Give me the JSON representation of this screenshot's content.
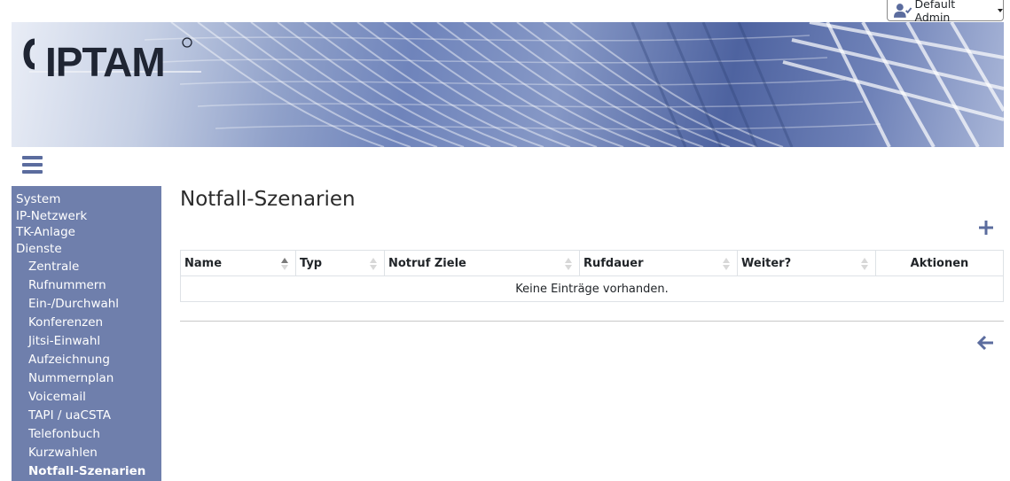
{
  "user": {
    "name": "Default Admin",
    "icon": "user-check-icon"
  },
  "logo": {
    "text": "IPTAM"
  },
  "sidebar": {
    "top_items": [
      {
        "label": "System"
      },
      {
        "label": "IP-Netzwerk"
      },
      {
        "label": "TK-Anlage"
      },
      {
        "label": "Dienste"
      }
    ],
    "sub_items": [
      {
        "label": "Zentrale"
      },
      {
        "label": "Rufnummern"
      },
      {
        "label": "Ein-/Durchwahl"
      },
      {
        "label": "Konferenzen"
      },
      {
        "label": "Jitsi-Einwahl"
      },
      {
        "label": "Aufzeichnung"
      },
      {
        "label": "Nummernplan"
      },
      {
        "label": "Voicemail"
      },
      {
        "label": "TAPI / uaCSTA"
      },
      {
        "label": "Telefonbuch"
      },
      {
        "label": "Kurzwahlen"
      },
      {
        "label": "Notfall-Szenarien",
        "active": true
      }
    ]
  },
  "main": {
    "title": "Notfall-Szenarien",
    "table": {
      "columns": [
        {
          "label": "Name",
          "sort": "asc"
        },
        {
          "label": "Typ",
          "sort": "none"
        },
        {
          "label": "Notruf Ziele",
          "sort": "none"
        },
        {
          "label": "Rufdauer",
          "sort": "none"
        },
        {
          "label": "Weiter?",
          "sort": "none"
        },
        {
          "label": "Aktionen"
        }
      ],
      "empty_text": "Keine Einträge vorhanden."
    }
  },
  "colors": {
    "accent": "#5b6c9e",
    "sidebar": "#6f7fac"
  }
}
